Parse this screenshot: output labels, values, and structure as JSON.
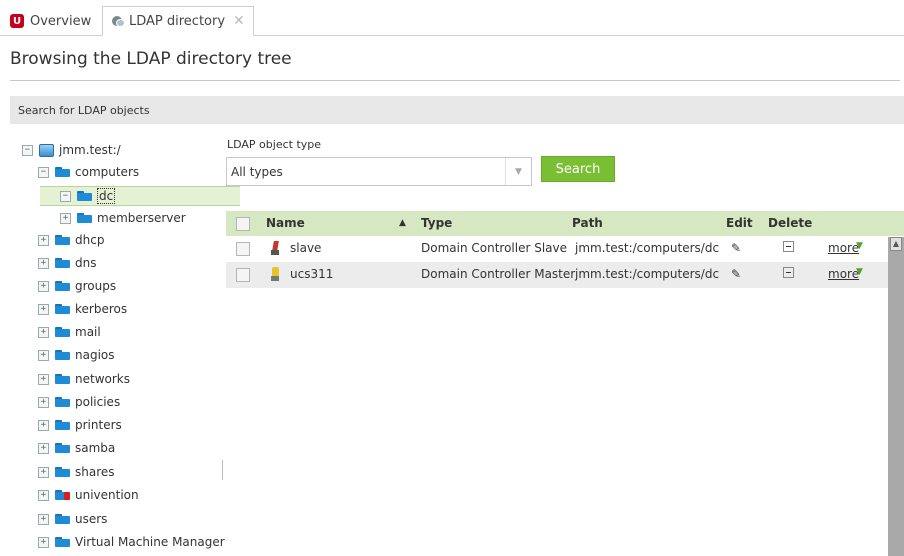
{
  "tabs": [
    {
      "label": "Overview",
      "icon": "univention-logo-icon"
    },
    {
      "label": "LDAP directory",
      "icon": "ldap-icon",
      "close": "✕"
    }
  ],
  "page_title": "Browsing the LDAP directory tree",
  "section_header": "Search for LDAP objects",
  "tree": {
    "root": "jmm.test:/",
    "items": [
      {
        "label": "computers",
        "expander": "−"
      },
      {
        "label": "dc",
        "expander": "−"
      },
      {
        "label": "memberserver",
        "expander": "+"
      },
      {
        "label": "dhcp",
        "expander": "+"
      },
      {
        "label": "dns",
        "expander": "+"
      },
      {
        "label": "groups",
        "expander": "+"
      },
      {
        "label": "kerberos",
        "expander": "+"
      },
      {
        "label": "mail",
        "expander": "+"
      },
      {
        "label": "nagios",
        "expander": "+"
      },
      {
        "label": "networks",
        "expander": "+"
      },
      {
        "label": "policies",
        "expander": "+"
      },
      {
        "label": "printers",
        "expander": "+"
      },
      {
        "label": "samba",
        "expander": "+"
      },
      {
        "label": "shares",
        "expander": "+"
      },
      {
        "label": "univention",
        "expander": "+"
      },
      {
        "label": "users",
        "expander": "+"
      },
      {
        "label": "Virtual Machine Manager",
        "expander": "+"
      }
    ],
    "root_expander": "−"
  },
  "search": {
    "type_label": "LDAP object type",
    "type_value": "All types",
    "button_label": "Search"
  },
  "grid": {
    "columns": {
      "name": "Name",
      "sort_indicator": "▲",
      "type": "Type",
      "path": "Path",
      "edit": "Edit",
      "delete": "Delete"
    },
    "rows": [
      {
        "name": "slave",
        "type": "Domain Controller Slave",
        "path": "jmm.test:/computers/dc",
        "more": "more"
      },
      {
        "name": "ucs311",
        "type": "Domain Controller Master",
        "path": "jmm.test:/computers/dc",
        "more": "more"
      }
    ]
  },
  "colors": {
    "accent_green": "#7abf33",
    "header_green": "#d6e8c2",
    "univention_red": "#c4001a",
    "folder_blue": "#1f8ad6"
  }
}
